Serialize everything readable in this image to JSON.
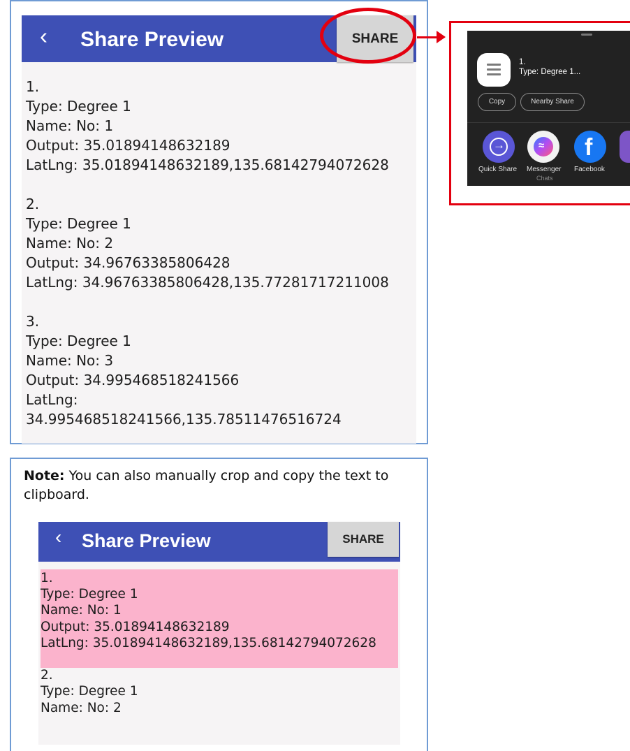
{
  "app": {
    "back_icon": "chevron-left-icon",
    "title": "Share Preview",
    "share_label": "SHARE",
    "colors": {
      "appbar": "#3e50b5",
      "annotation": "#e3000f",
      "highlight": "#fbb3cc"
    }
  },
  "entries": [
    {
      "num": "1.",
      "type": "Type: Degree 1",
      "name": "Name: No: 1",
      "output": "Output: 35.01894148632189",
      "latlng": "LatLng: 35.01894148632189,135.68142794072628"
    },
    {
      "num": "2.",
      "type": "Type: Degree 1",
      "name": "Name: No: 2",
      "output": "Output: 34.96763385806428",
      "latlng": "LatLng: 34.96763385806428,135.77281717211008"
    },
    {
      "num": "3.",
      "type": "Type: Degree 1",
      "name": "Name: No: 3",
      "output": "Output: 34.995468518241566",
      "latlng_label": "LatLng:",
      "latlng_value": "34.995468518241566,135.78511476516724"
    }
  ],
  "share_sheet": {
    "preview_num": "1.",
    "preview_text": "Type: Degree 1...",
    "chips": [
      "Copy",
      "Nearby Share"
    ],
    "apps": [
      {
        "label": "Quick Share",
        "icon": "quick-share-icon"
      },
      {
        "label": "Messenger",
        "sublabel": "Chats",
        "icon": "messenger-icon"
      },
      {
        "label": "Facebook",
        "icon": "facebook-icon"
      },
      {
        "label": "",
        "icon": "viber-icon"
      }
    ]
  },
  "note": {
    "bold": "Note:",
    "text": " You can also manually crop and copy the text to clipboard."
  }
}
